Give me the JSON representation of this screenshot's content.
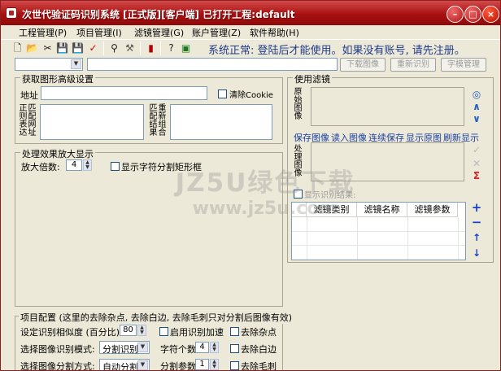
{
  "window": {
    "title": "次世代验证码识别系统 [正式版][客户端] 已打开工程:default",
    "minimize_label": "–",
    "maximize_label": "□",
    "close_label": "×"
  },
  "menu": [
    "工程管理(P)",
    "项目管理(I)",
    "滤镜管理(G)",
    "账户管理(Z)",
    "软件帮助(H)"
  ],
  "toolbar": {
    "icons": [
      "new-icon",
      "open-icon",
      "cut-icon",
      "save-icon",
      "save-all-icon",
      "check-icon",
      "binoculars-icon",
      "tools-icon",
      "chart-icon",
      "help-icon",
      "image-icon"
    ],
    "status": "系统正常: 登陆后才能使用。如果没有账号, 请先注册。"
  },
  "row2": {
    "download": "下载图像",
    "recognize": "重新识别",
    "font_manage": "字模管理"
  },
  "get_panel": {
    "title": "获取图形高级设置",
    "address": "地址",
    "clear_cookie": "清除Cookie",
    "regex": "正则表达",
    "match_url": "匹配网址",
    "match_result": "匹配结果",
    "regroup": "重新组合"
  },
  "zoom_panel": {
    "title": "处理效果放大显示",
    "zoom_label": "放大倍数:",
    "zoom_value": "4",
    "show_rect": "显示字符分割矩形框"
  },
  "filter_panel": {
    "title": "使用滤镜",
    "original": "原始图像",
    "processed": "处理图像",
    "links": [
      "保存图像",
      "读入图像",
      "连续保存",
      "显示原图",
      "刷新显示"
    ],
    "result_label": "显示识别结果:",
    "columns": [
      "滤镜类别",
      "滤镜名称",
      "滤镜参数"
    ]
  },
  "project_panel": {
    "title": "项目配置 (这里的去除杂点, 去除白边, 去除毛刺只对分割后图像有效)",
    "similarity_label": "设定识别相似度 (百分比):",
    "similarity_value": "80",
    "accelerate": "启用识别加速",
    "remove_noise": "去除杂点",
    "mode_label": "选择图像识别模式:",
    "mode_value": "分割识别",
    "char_count_label": "字符个数",
    "char_count_value": "4",
    "remove_border": "去除白边",
    "split_label": "选择图像分割方式:",
    "split_value": "自动分割",
    "split_param_label": "分割参数",
    "split_param_value": "1",
    "remove_burr": "去除毛刺"
  },
  "side_icons": [
    "target-icon",
    "up-icon",
    "down-icon",
    "check-icon",
    "close-icon",
    "sigma-icon"
  ],
  "grid_icons": [
    "plus-icon",
    "minus-icon",
    "move-up-icon",
    "move-down-icon"
  ],
  "watermark": {
    "big": "JZ5U绿色下载",
    "small": "www.jz5u.com"
  },
  "colors": {
    "titlebar": "#a91010",
    "accent": "#1a3fa0",
    "face": "#ECE9D8"
  }
}
